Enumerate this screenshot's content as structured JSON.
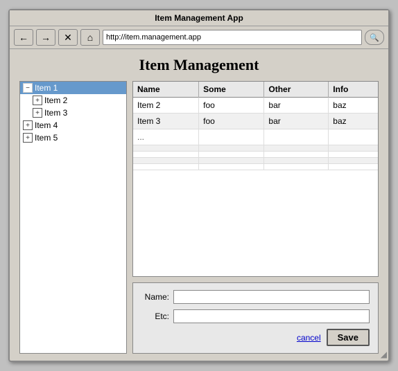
{
  "window": {
    "title": "Item Management App"
  },
  "toolbar": {
    "url": "http://item.management.app",
    "back_icon": "←",
    "forward_icon": "→",
    "stop_icon": "✕",
    "home_icon": "⌂",
    "search_icon": "🔍"
  },
  "page": {
    "title": "Item Management"
  },
  "sidebar": {
    "items": [
      {
        "id": "item1",
        "label": "Item 1",
        "level": 0,
        "expanded": true,
        "selected": true,
        "icon": "−"
      },
      {
        "id": "item2",
        "label": "Item 2",
        "level": 1,
        "expanded": false,
        "selected": false,
        "icon": "+"
      },
      {
        "id": "item3",
        "label": "Item 3",
        "level": 1,
        "expanded": false,
        "selected": false,
        "icon": "+"
      },
      {
        "id": "item4",
        "label": "Item 4",
        "level": 0,
        "expanded": false,
        "selected": false,
        "icon": "+"
      },
      {
        "id": "item5",
        "label": "Item 5",
        "level": 0,
        "expanded": false,
        "selected": false,
        "icon": "+"
      }
    ]
  },
  "table": {
    "columns": [
      "Name",
      "Some",
      "Other",
      "Info"
    ],
    "rows": [
      {
        "name": "Item 2",
        "some": "foo",
        "other": "bar",
        "info": "baz"
      },
      {
        "name": "Item 3",
        "some": "foo",
        "other": "bar",
        "info": "baz"
      },
      {
        "name": "...",
        "some": "",
        "other": "",
        "info": ""
      }
    ]
  },
  "form": {
    "name_label": "Name:",
    "etc_label": "Etc:",
    "name_value": "",
    "etc_value": "",
    "cancel_label": "cancel",
    "save_label": "Save"
  }
}
